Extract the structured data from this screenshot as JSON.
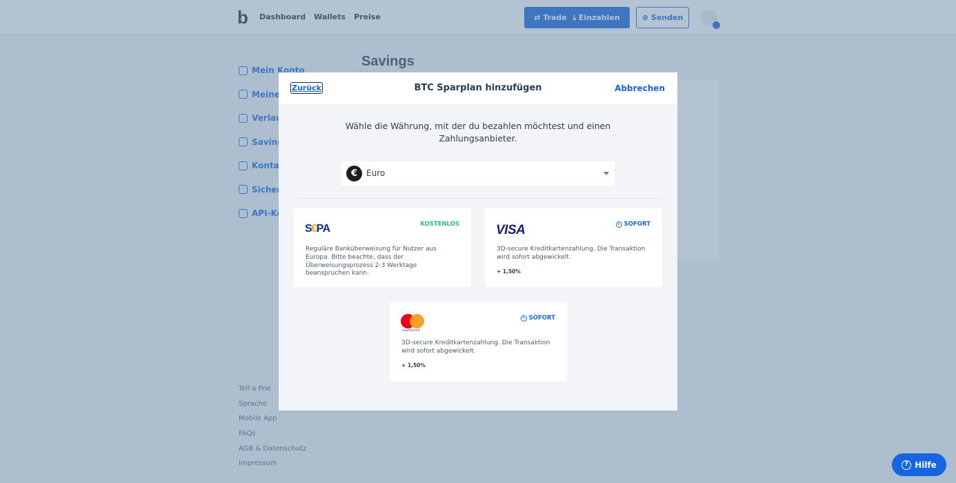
{
  "header": {
    "logo": "b",
    "nav": [
      "Dashboard",
      "Wallets",
      "Preise"
    ],
    "trade_label": "Trade",
    "deposit_label": "Einzahlen",
    "send_label": "Senden"
  },
  "sidebar": {
    "items": [
      {
        "label": "Mein Konto"
      },
      {
        "label": "Meine"
      },
      {
        "label": "Verlau"
      },
      {
        "label": "Savings"
      },
      {
        "label": "Kontak"
      },
      {
        "label": "Sicher"
      },
      {
        "label": "API-Ke"
      }
    ]
  },
  "main": {
    "title": "Savings"
  },
  "footer": {
    "links": [
      "Tell a Frie",
      "Sprache",
      "Mobile App",
      "FAQs",
      "AGB & Datenschutz",
      "Impressum"
    ]
  },
  "modal": {
    "back_label": "Zurück",
    "title": "BTC Sparplan hinzufügen",
    "cancel_label": "Abbrechen",
    "instruction": "Wähle die Währung, mit der du bezahlen möchtest und einen Zahlungsanbieter.",
    "currency": {
      "symbol": "€",
      "value": "Euro"
    },
    "providers": {
      "sepa": {
        "logo_left": "S",
        "logo_mid": "€",
        "logo_right": "PA",
        "badge": "KOSTENLOS",
        "description": "Reguläre Banküberweisung für Nutzer aus Europa. Bitte beachte, dass der Überweisungsprozess 2-3 Werktage beanspruchen kann."
      },
      "visa": {
        "logo": "VISA",
        "badge": "SOFORT",
        "description": "3D-secure Kreditkartenzahlung. Die Transaktion wird sofort abgewickelt.",
        "fee": "+ 1,50%"
      },
      "mastercard": {
        "logo_text": "mastercard",
        "badge": "SOFORT",
        "description": "3D-secure Kreditkartenzahlung. Die Transaktion wird sofort abgewickelt.",
        "fee": "+ 1,50%"
      }
    }
  },
  "help": {
    "label": "Hilfe",
    "icon": "?"
  },
  "colors": {
    "primary": "#1665e0",
    "free_badge": "#23c47a",
    "overlay": "rgba(104,136,164,0.5)"
  }
}
